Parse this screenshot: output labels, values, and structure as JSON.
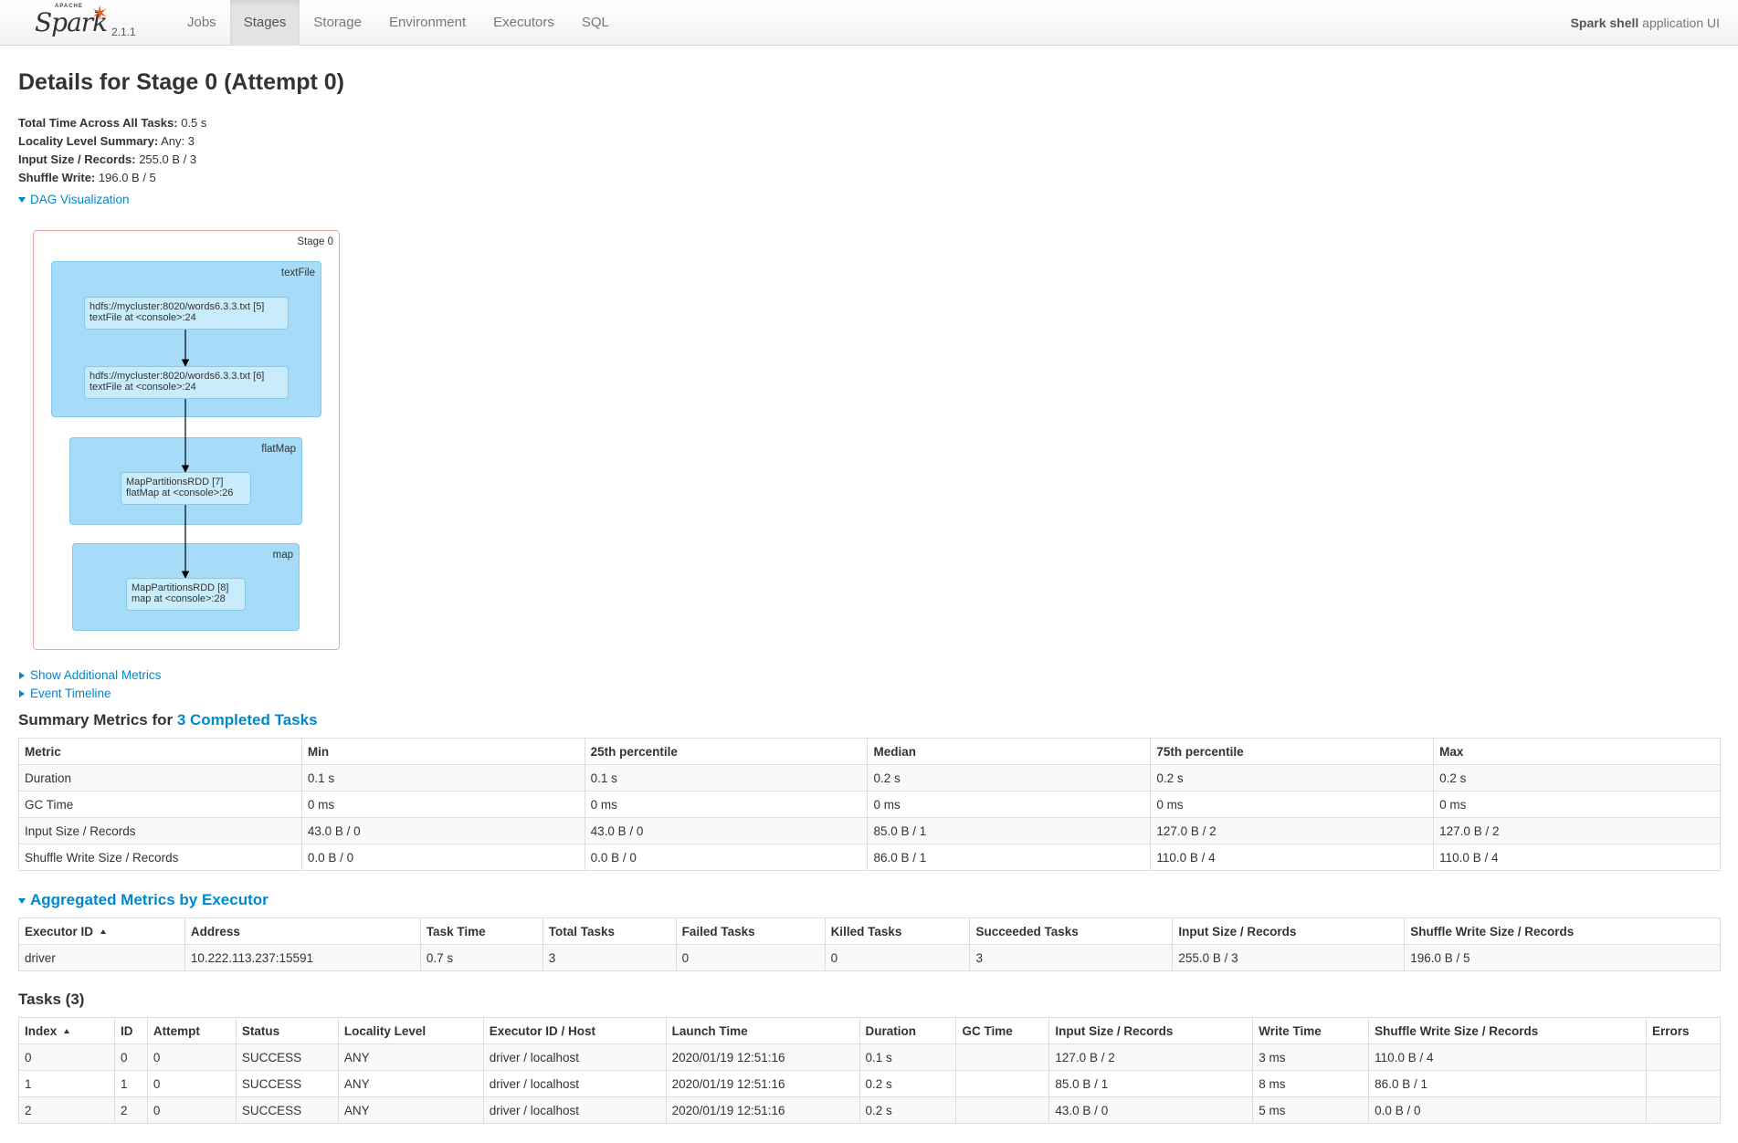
{
  "nav": {
    "brand_apache": "APACHE",
    "brand_name": "Spark",
    "version": "2.1.1",
    "tabs": [
      {
        "label": "Jobs"
      },
      {
        "label": "Stages"
      },
      {
        "label": "Storage"
      },
      {
        "label": "Environment"
      },
      {
        "label": "Executors"
      },
      {
        "label": "SQL"
      }
    ],
    "app_name_bold": "Spark shell",
    "app_name_rest": " application UI"
  },
  "title": "Details for Stage 0 (Attempt 0)",
  "summary": {
    "total_time_label": "Total Time Across All Tasks:",
    "total_time_value": "0.5 s",
    "locality_label": "Locality Level Summary:",
    "locality_value": "Any: 3",
    "input_label": "Input Size / Records:",
    "input_value": "255.0 B / 3",
    "shuffle_label": "Shuffle Write:",
    "shuffle_value": "196.0 B / 5"
  },
  "dag": {
    "toggle": "DAG Visualization",
    "stage_label": "Stage 0",
    "clusters": [
      {
        "label": "textFile"
      },
      {
        "label": "flatMap"
      },
      {
        "label": "map"
      }
    ],
    "nodes": [
      {
        "line1": "hdfs://mycluster:8020/words6.3.3.txt [5]",
        "line2": "textFile at <console>:24"
      },
      {
        "line1": "hdfs://mycluster:8020/words6.3.3.txt [6]",
        "line2": "textFile at <console>:24"
      },
      {
        "line1": "MapPartitionsRDD [7]",
        "line2": "flatMap at <console>:26"
      },
      {
        "line1": "MapPartitionsRDD [8]",
        "line2": "map at <console>:28"
      }
    ]
  },
  "links": {
    "additional_metrics": "Show Additional Metrics",
    "event_timeline": "Event Timeline"
  },
  "summary_metrics": {
    "heading_prefix": "Summary Metrics for ",
    "heading_link": "3 Completed Tasks",
    "columns": [
      "Metric",
      "Min",
      "25th percentile",
      "Median",
      "75th percentile",
      "Max"
    ],
    "rows": [
      [
        "Duration",
        "0.1 s",
        "0.1 s",
        "0.2 s",
        "0.2 s",
        "0.2 s"
      ],
      [
        "GC Time",
        "0 ms",
        "0 ms",
        "0 ms",
        "0 ms",
        "0 ms"
      ],
      [
        "Input Size / Records",
        "43.0 B / 0",
        "43.0 B / 0",
        "85.0 B / 1",
        "127.0 B / 2",
        "127.0 B / 2"
      ],
      [
        "Shuffle Write Size / Records",
        "0.0 B / 0",
        "0.0 B / 0",
        "86.0 B / 1",
        "110.0 B / 4",
        "110.0 B / 4"
      ]
    ]
  },
  "aggregated": {
    "heading": "Aggregated Metrics by Executor",
    "columns": [
      "Executor ID",
      "Address",
      "Task Time",
      "Total Tasks",
      "Failed Tasks",
      "Killed Tasks",
      "Succeeded Tasks",
      "Input Size / Records",
      "Shuffle Write Size / Records"
    ],
    "rows": [
      [
        "driver",
        "10.222.113.237:15591",
        "0.7 s",
        "3",
        "0",
        "0",
        "3",
        "255.0 B / 3",
        "196.0 B / 5"
      ]
    ]
  },
  "tasks": {
    "heading": "Tasks (3)",
    "columns": [
      "Index",
      "ID",
      "Attempt",
      "Status",
      "Locality Level",
      "Executor ID / Host",
      "Launch Time",
      "Duration",
      "GC Time",
      "Input Size / Records",
      "Write Time",
      "Shuffle Write Size / Records",
      "Errors"
    ],
    "rows": [
      [
        "0",
        "0",
        "0",
        "SUCCESS",
        "ANY",
        "driver / localhost",
        "2020/01/19 12:51:16",
        "0.1 s",
        "",
        "127.0 B / 2",
        "3 ms",
        "110.0 B / 4",
        ""
      ],
      [
        "1",
        "1",
        "0",
        "SUCCESS",
        "ANY",
        "driver / localhost",
        "2020/01/19 12:51:16",
        "0.2 s",
        "",
        "85.0 B / 1",
        "8 ms",
        "86.0 B / 1",
        ""
      ],
      [
        "2",
        "2",
        "0",
        "SUCCESS",
        "ANY",
        "driver / localhost",
        "2020/01/19 12:51:16",
        "0.2 s",
        "",
        "43.0 B / 0",
        "5 ms",
        "0.0 B / 0",
        ""
      ]
    ]
  }
}
